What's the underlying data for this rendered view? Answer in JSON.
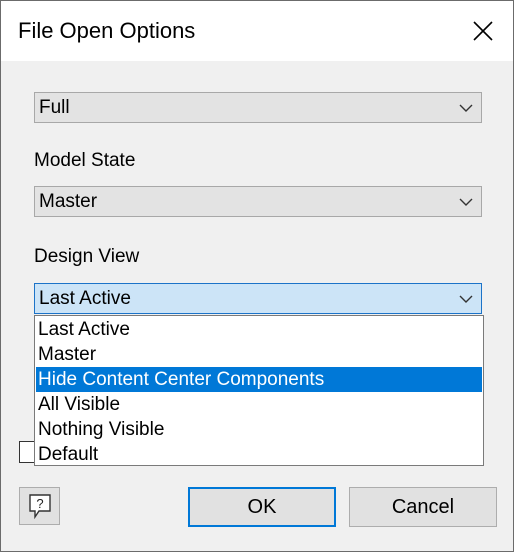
{
  "dialog": {
    "title": "File Open Options",
    "close_icon": "close-icon"
  },
  "fields": {
    "level_of_detail": {
      "value": "Full"
    },
    "model_state": {
      "label": "Model State",
      "value": "Master"
    },
    "design_view": {
      "label": "Design View",
      "value": "Last Active"
    }
  },
  "dropdown": {
    "options": [
      "Last Active",
      "Master",
      "Hide Content Center Components",
      "All Visible",
      "Nothing Visible",
      "Default"
    ],
    "highlighted": "Hide Content Center Components"
  },
  "buttons": {
    "help_icon": "help-icon",
    "ok": "OK",
    "cancel": "Cancel"
  },
  "colors": {
    "accent": "#0078d7",
    "active_combo_bg": "#cce4f7"
  }
}
